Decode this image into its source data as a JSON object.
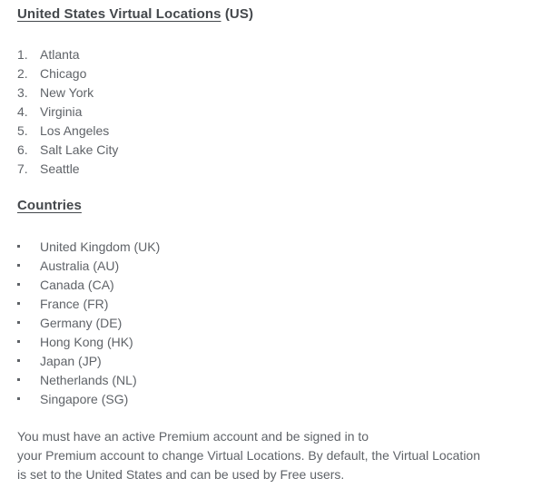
{
  "document": {
    "background_color": "#ffffff",
    "heading_color": "#44484c",
    "body_color": "#5f6368"
  },
  "us_section": {
    "heading_main": "United States Virtual Locations",
    "heading_suffix": " (US)",
    "list_type": "ordered",
    "items": [
      {
        "number": "1.",
        "label": "Atlanta"
      },
      {
        "number": "2.",
        "label": "Chicago"
      },
      {
        "number": "3.",
        "label": "New York"
      },
      {
        "number": "4.",
        "label": "Virginia"
      },
      {
        "number": "5.",
        "label": "Los Angeles"
      },
      {
        "number": "6.",
        "label": "Salt Lake City"
      },
      {
        "number": "7.",
        "label": "Seattle"
      }
    ]
  },
  "countries_section": {
    "heading_main": "Countries",
    "list_type": "unordered",
    "items": [
      {
        "label": "United Kingdom (UK)"
      },
      {
        "label": "Australia (AU)"
      },
      {
        "label": "Canada (CA)"
      },
      {
        "label": "France (FR)"
      },
      {
        "label": "Germany (DE)"
      },
      {
        "label": "Hong Kong (HK)"
      },
      {
        "label": "Japan (JP)"
      },
      {
        "label": "Netherlands (NL)"
      },
      {
        "label": "Singapore (SG)"
      }
    ]
  },
  "note": {
    "lines": [
      "You must have an active Premium account and be signed in to",
      "your Premium account to change Virtual Locations. By default, the Virtual Location",
      "is set to the United States and can be used by Free users."
    ]
  }
}
